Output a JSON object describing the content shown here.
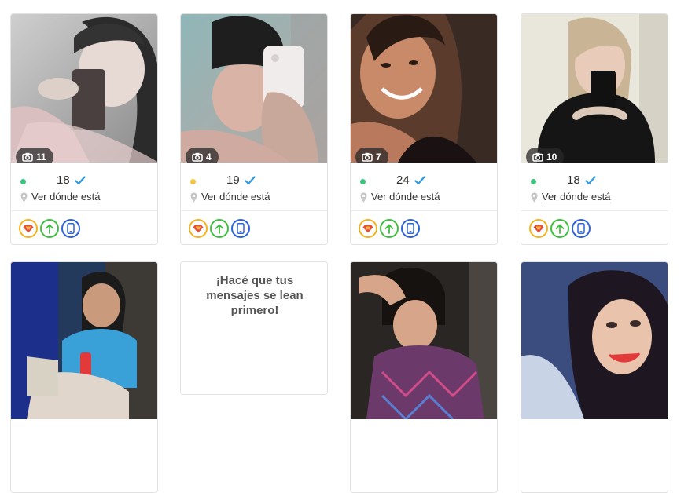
{
  "cards": [
    {
      "photo_count": "11",
      "age": "18",
      "location_link": "Ver dónde está",
      "status_color": "#3cc47c",
      "verified": true
    },
    {
      "photo_count": "4",
      "age": "19",
      "location_link": "Ver dónde está",
      "status_color": "#f5c342",
      "verified": true
    },
    {
      "photo_count": "7",
      "age": "24",
      "location_link": "Ver dónde está",
      "status_color": "#3cc47c",
      "verified": true
    },
    {
      "photo_count": "10",
      "age": "18",
      "location_link": "Ver dónde está",
      "status_color": "#3cc47c",
      "verified": true
    }
  ],
  "promo": {
    "text": "¡Hacé que tus mensajes se lean primero!"
  },
  "colors": {
    "verified": "#2f9ae0",
    "super_badge": "#f3b320",
    "boost_badge": "#3fbf3f",
    "mobile_badge": "#2e62d9"
  },
  "icons": [
    "camera-icon",
    "check-icon",
    "location-pin-icon",
    "superman-badge-icon",
    "arrow-up-icon",
    "mobile-phone-icon"
  ]
}
